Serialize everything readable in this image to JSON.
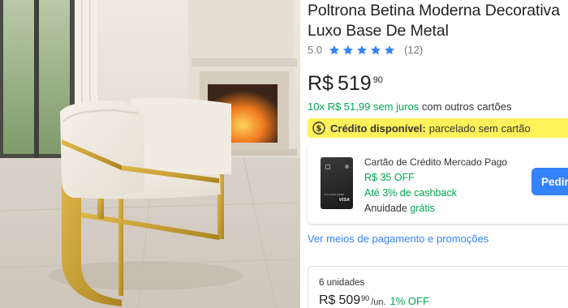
{
  "product": {
    "title": "Poltrona Betina Moderna Decorativa Luxo Base De Metal",
    "rating_score": "5.0",
    "rating_stars": 5,
    "review_count": "(12)",
    "price_currency": "R$",
    "price_integer": "519",
    "price_cents": "90"
  },
  "installments": {
    "highlight": "10x R$ 51,99 sem juros",
    "rest": "com outros cartões"
  },
  "credit_banner": {
    "icon": "dollar-coin-icon",
    "label": "Crédito disponível:",
    "text": "parcelado sem cartão"
  },
  "card_offer": {
    "title": "Cartão de Crédito Mercado Pago",
    "discount": "R$ 35 OFF",
    "cashback": "Até 3% de cashback",
    "annuity_label": "Anuidade",
    "annuity_value": "grátis",
    "button_label": "Pedir",
    "card_brand_text": "mercado pago",
    "card_network": "VISA"
  },
  "payment_link": "Ver meios de pagamento e promoções",
  "bulk": {
    "units": "6 unidades",
    "currency": "R$",
    "integer": "509",
    "cents": "90",
    "per_unit": "/un.",
    "discount": "1% OFF"
  },
  "colors": {
    "accent_blue": "#3483fa",
    "green": "#00a650",
    "yellow_banner": "#fff159",
    "gold_frame": "#c9a13a"
  }
}
